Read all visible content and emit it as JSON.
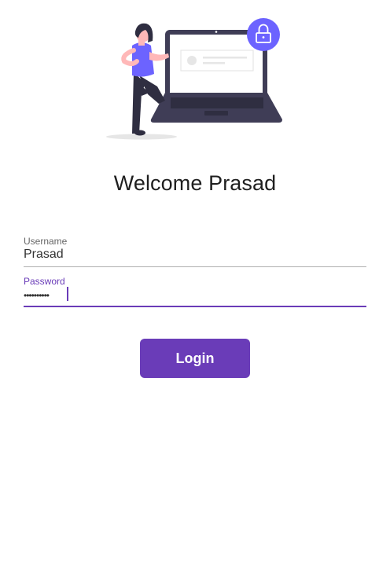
{
  "welcome_title": "Welcome Prasad",
  "form": {
    "username": {
      "label": "Username",
      "value": "Prasad"
    },
    "password": {
      "label": "Password",
      "masked_value": "••••••••••"
    }
  },
  "login_button": {
    "label": "Login"
  },
  "colors": {
    "accent": "#6a3cb8",
    "illustration_purple": "#6c63ff",
    "laptop_dark": "#3f3d56"
  },
  "illustration": {
    "icon": "woman-with-laptop-lock-illustration"
  }
}
